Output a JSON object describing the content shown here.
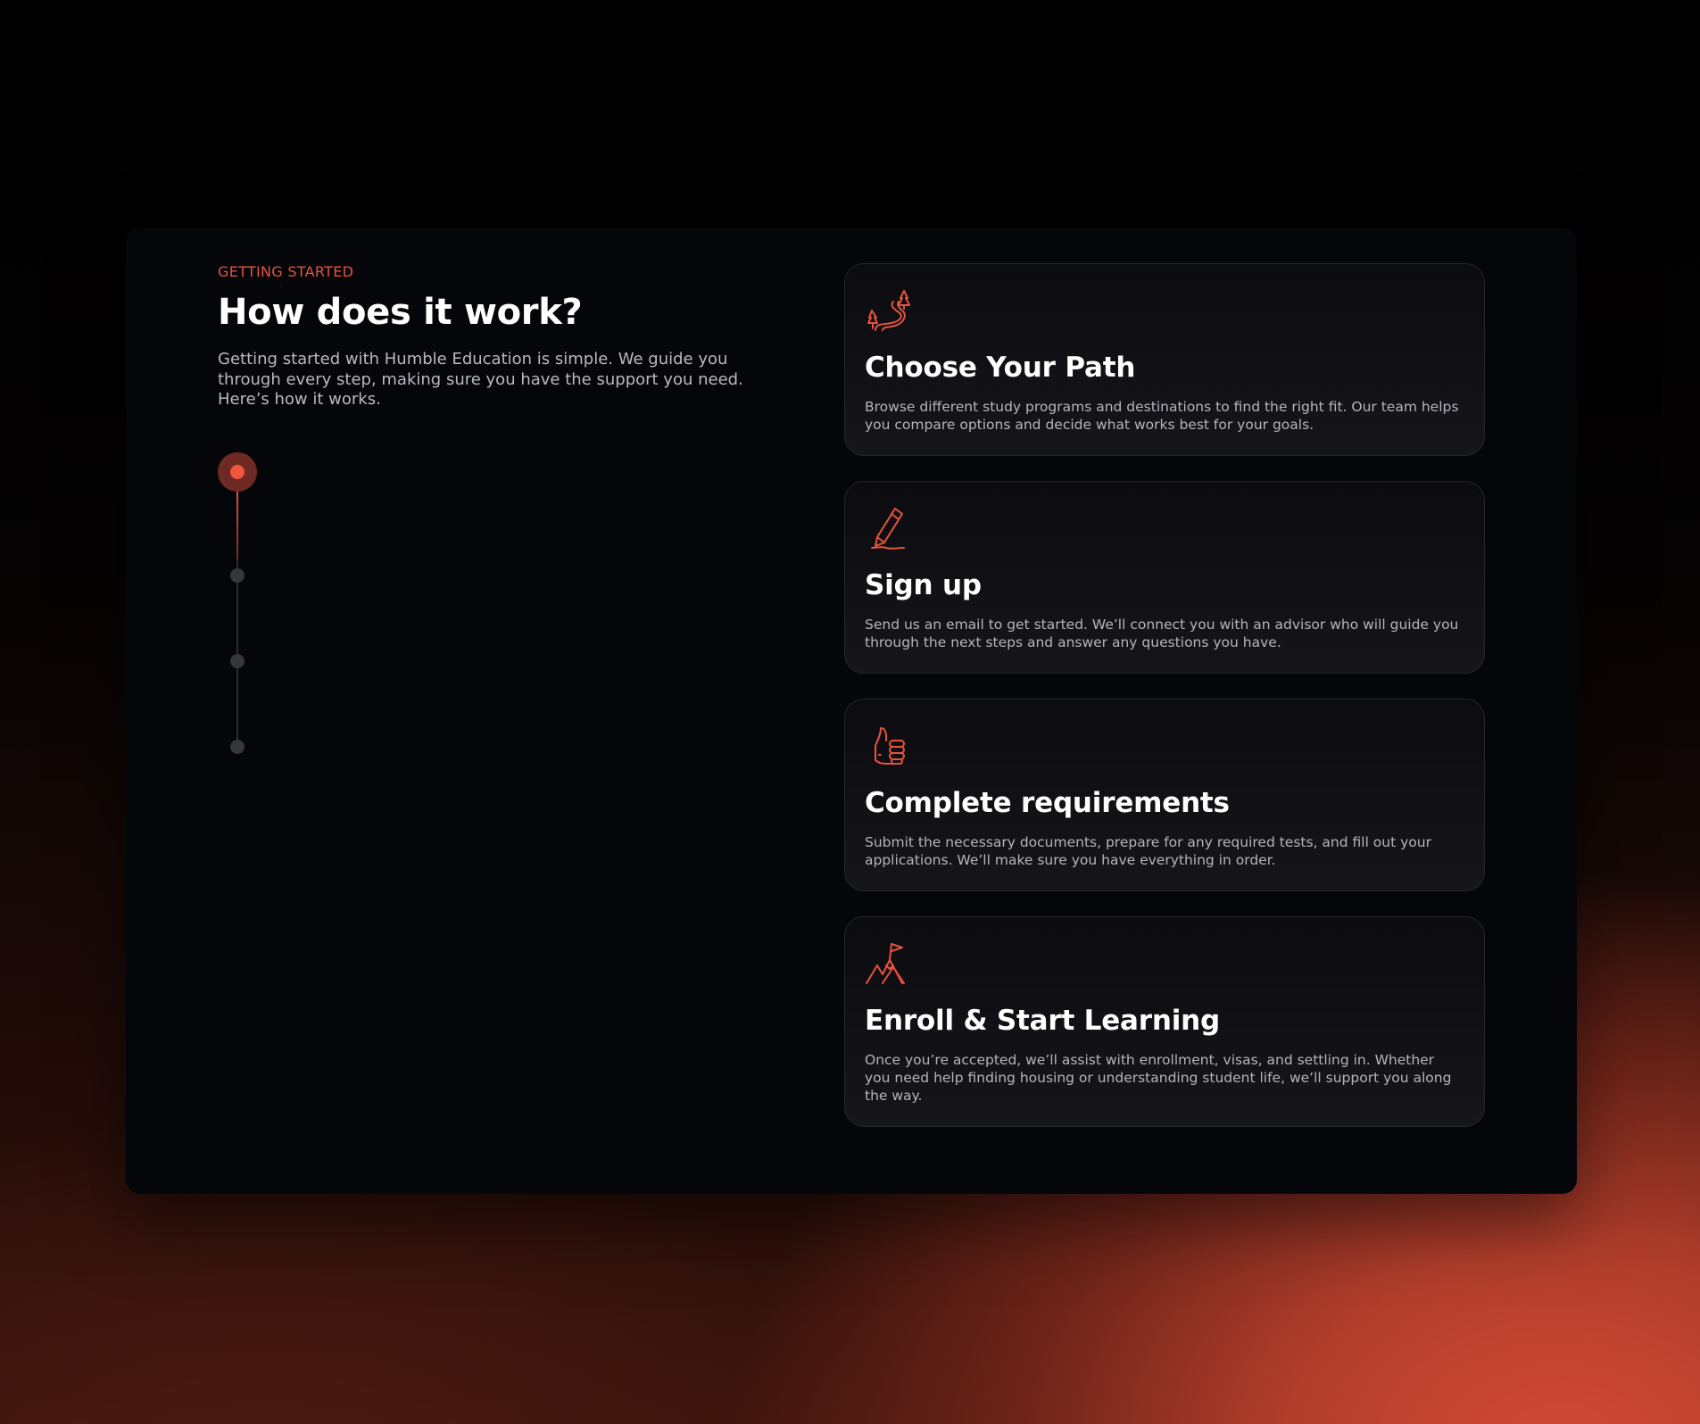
{
  "section": {
    "eyebrow": "GETTING STARTED",
    "title": "How does it work?",
    "description": "Getting started with Humble Education is simple. We guide you through every step, making sure you have the support you need. Here’s how it works."
  },
  "timeline": {
    "active_step": 1,
    "total_steps": 4
  },
  "steps": [
    {
      "icon": "winding-path-icon",
      "title": "Choose Your Path",
      "description": "Browse different study programs and destinations to find the right fit. Our team helps you compare options and decide what works best for your goals."
    },
    {
      "icon": "pencil-icon",
      "title": "Sign up",
      "description": "Send us an email to get started. We’ll connect you with an advisor who will guide you through the next steps and answer any questions you have."
    },
    {
      "icon": "thumbs-up-icon",
      "title": "Complete requirements",
      "description": "Submit the necessary documents, prepare for any required tests, and fill out your applications. We’ll make sure you have everything in order."
    },
    {
      "icon": "mountain-flag-icon",
      "title": "Enroll & Start Learning",
      "description": "Once you’re accepted, we’ll assist with enrollment, visas, and settling in. Whether you need help finding housing or understanding student life, we’ll support you along the way."
    }
  ],
  "colors": {
    "accent": "#e5533d",
    "panel_background": "#05060a",
    "card_border": "#26262b",
    "heading_text": "#ffffff",
    "body_text": "#b4b4ba"
  }
}
